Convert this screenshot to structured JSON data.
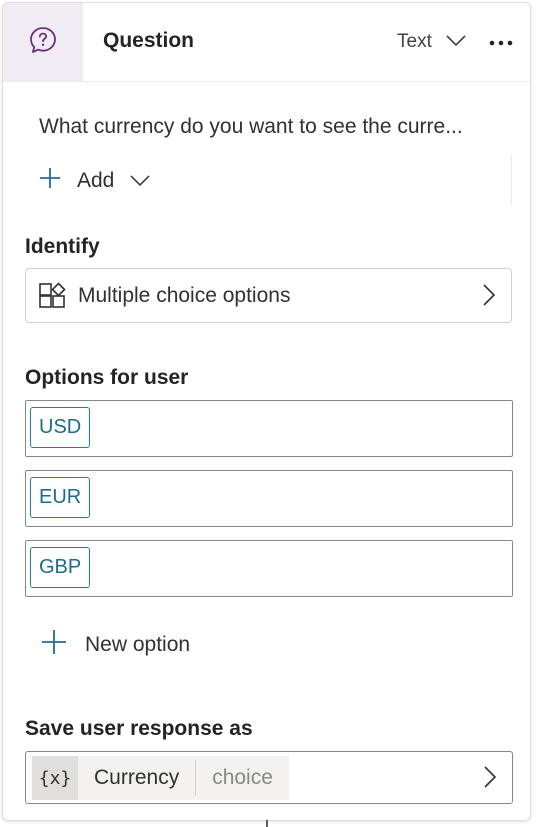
{
  "header": {
    "title": "Question",
    "type_label": "Text",
    "icons": {
      "question": "question-circle-icon",
      "type_dropdown": "chevron-down-icon",
      "more": "more-horizontal-icon"
    }
  },
  "message": {
    "text": "What currency do you want to see the curre...",
    "add_label": "Add"
  },
  "identify": {
    "heading": "Identify",
    "value": "Multiple choice options",
    "icon": "shapes-icon"
  },
  "options": {
    "heading": "Options for user",
    "items": [
      "USD",
      "EUR",
      "GBP"
    ],
    "new_option_label": "New option"
  },
  "save": {
    "heading": "Save user response as",
    "variable_icon": "{x}",
    "variable_name": "Currency",
    "variable_type": "choice"
  },
  "colors": {
    "accent_purple": "#6b2e7a",
    "header_icon_bg": "#f1ebf3",
    "chip_border": "#1f7f9e",
    "chip_text": "#1a6e8c",
    "plus_blue": "#1f6f9a"
  }
}
